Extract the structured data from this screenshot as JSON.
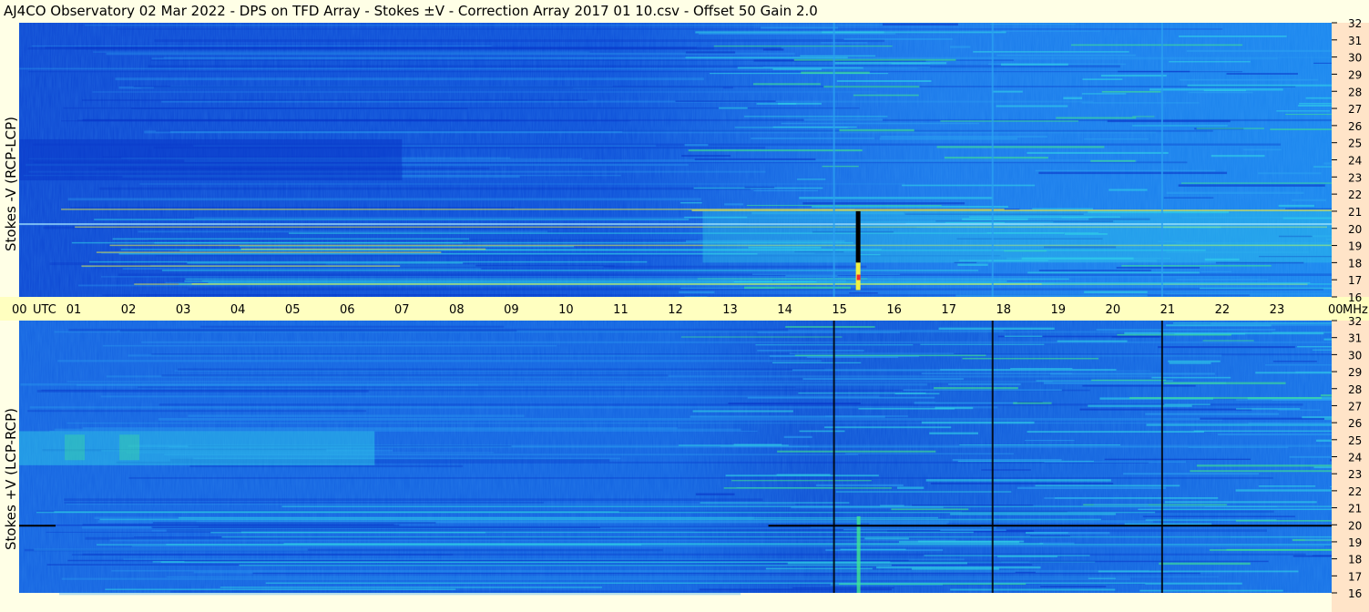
{
  "title": "AJ4CO Observatory  02 Mar 2022  -  DPS on TFD Array  -  Stokes ±V  -  Correction Array 2017 01 10.csv  -  Offset 50  Gain 2.0",
  "colors": {
    "background": "#ffffe6",
    "freq_strip": "#ffe4c8",
    "deep_blue": "#0a36c8",
    "mid_blue": "#1668e6",
    "light_blue": "#2aa0f0",
    "cyan": "#30d4e8",
    "green": "#40e890",
    "yellow": "#f0f040",
    "red": "#f03030",
    "black": "#000000"
  },
  "chart_data": [
    {
      "type": "heatmap",
      "name_label": "Stokes -V (RCP-LCP)",
      "x_unit": "UTC",
      "y_unit": "MHz",
      "x_range": [
        0,
        24
      ],
      "y_range": [
        16,
        32
      ],
      "y_ticks": [
        "32",
        "31",
        "30",
        "29",
        "28",
        "27",
        "26",
        "25",
        "24",
        "23",
        "22",
        "21",
        "20",
        "19",
        "18",
        "17",
        "16"
      ],
      "features": {
        "vertical_lines_utc": [
          14.9,
          15.35,
          17.8,
          20.9
        ],
        "vertical_line_color": "light_blue",
        "dark_burst_utc": 15.35
      }
    },
    {
      "type": "heatmap",
      "name_label": "Stokes +V (LCP-RCP)",
      "x_unit": "UTC",
      "y_unit": "MHz",
      "x_range": [
        0,
        24
      ],
      "y_range": [
        16,
        32
      ],
      "y_ticks": [
        "32",
        "31",
        "30",
        "29",
        "28",
        "27",
        "26",
        "25",
        "24",
        "23",
        "22",
        "21",
        "20",
        "19",
        "18",
        "17",
        "16"
      ],
      "features": {
        "vertical_lines_utc": [
          14.9,
          15.35,
          17.8,
          20.9
        ],
        "vertical_line_color": "black",
        "horizontal_line_mhz": 20
      }
    }
  ],
  "x_axis": {
    "labels": [
      "00",
      "01",
      "02",
      "03",
      "04",
      "05",
      "06",
      "07",
      "08",
      "09",
      "10",
      "11",
      "12",
      "13",
      "14",
      "15",
      "16",
      "17",
      "18",
      "19",
      "20",
      "21",
      "22",
      "23",
      "00"
    ],
    "first_unit": "UTC",
    "last_unit": "MHz"
  }
}
